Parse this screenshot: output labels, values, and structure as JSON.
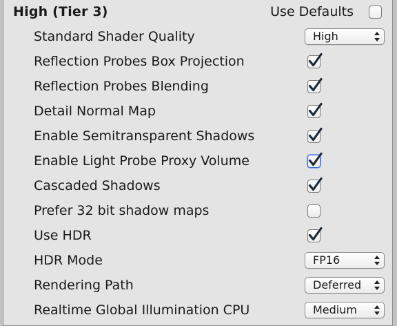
{
  "header": {
    "title": "High (Tier 3)",
    "use_defaults_label": "Use Defaults",
    "use_defaults_checked": false
  },
  "settings": [
    {
      "label": "Standard Shader Quality",
      "type": "dropdown",
      "value": "High"
    },
    {
      "label": "Reflection Probes Box Projection",
      "type": "checkbox",
      "checked": true
    },
    {
      "label": "Reflection Probes Blending",
      "type": "checkbox",
      "checked": true
    },
    {
      "label": "Detail Normal Map",
      "type": "checkbox",
      "checked": true
    },
    {
      "label": "Enable Semitransparent Shadows",
      "type": "checkbox",
      "checked": true
    },
    {
      "label": "Enable Light Probe Proxy Volume",
      "type": "checkbox",
      "checked": true,
      "focused": true
    },
    {
      "label": "Cascaded Shadows",
      "type": "checkbox",
      "checked": true
    },
    {
      "label": "Prefer 32 bit shadow maps",
      "type": "checkbox",
      "checked": false
    },
    {
      "label": "Use HDR",
      "type": "checkbox",
      "checked": true
    },
    {
      "label": "HDR Mode",
      "type": "dropdown",
      "value": "FP16"
    },
    {
      "label": "Rendering Path",
      "type": "dropdown",
      "value": "Deferred"
    },
    {
      "label": "Realtime Global Illumination CPU",
      "type": "dropdown",
      "value": "Medium"
    }
  ],
  "colors": {
    "panel_background": "#e4e4e4",
    "checkmark": "#1c2a3a",
    "focus_ring": "#3b6fd6"
  },
  "icons": {
    "checkmark": "checkmark-icon",
    "dropdown_arrows": "up-down-arrows-icon"
  }
}
